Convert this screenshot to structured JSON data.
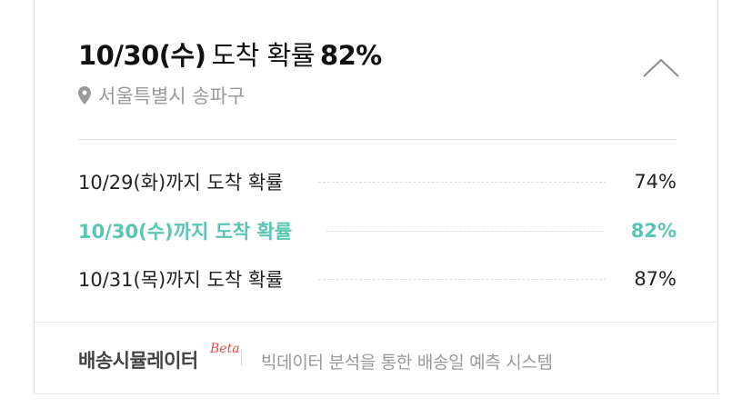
{
  "header": {
    "date": "10/30(수)",
    "label": "도착 확률",
    "percent": "82%",
    "location": "서울특별시 송파구"
  },
  "rows": [
    {
      "label": "10/29(화)까지 도착 확률",
      "value": "74%",
      "highlight": false
    },
    {
      "label": "10/30(수)까지 도착 확률",
      "value": "82%",
      "highlight": true
    },
    {
      "label": "10/31(목)까지 도착 확률",
      "value": "87%",
      "highlight": false
    }
  ],
  "footer": {
    "brand": "배송시뮬레이터",
    "badge": "Beta",
    "description": "빅데이터 분석을 통한 배송일 예측 시스템"
  },
  "colors": {
    "highlight": "#5bc5b3",
    "badge": "#e84848",
    "muted": "#999999"
  },
  "icons": {
    "location": "map-pin-icon",
    "toggle": "chevron-up-icon"
  }
}
